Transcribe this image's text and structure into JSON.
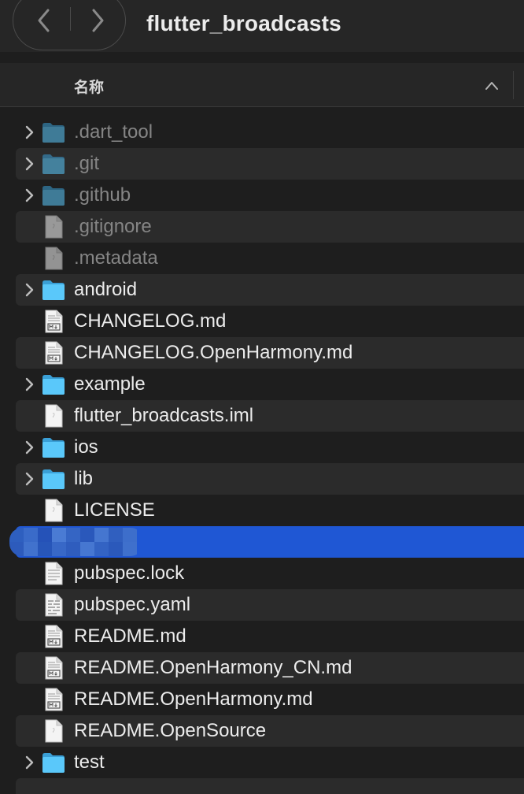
{
  "window": {
    "title": "flutter_broadcasts"
  },
  "toolbar": {
    "back_icon": "chevron-left-icon",
    "forward_icon": "chevron-right-icon"
  },
  "columns": {
    "name_label": "名称",
    "sort_icon": "chevron-up-icon",
    "sort_direction": "ascending"
  },
  "colors": {
    "background": "#1e1e1e",
    "stripe": "#2b2b2b",
    "selection": "#1f57d4",
    "folder": "#5ac8fa",
    "dim_text": "#858585"
  },
  "files": [
    {
      "name": ".dart_tool",
      "kind": "folder",
      "hidden": true
    },
    {
      "name": ".git",
      "kind": "folder",
      "hidden": true
    },
    {
      "name": ".github",
      "kind": "folder",
      "hidden": true
    },
    {
      "name": ".gitignore",
      "kind": "file",
      "hidden": true
    },
    {
      "name": ".metadata",
      "kind": "file",
      "hidden": true
    },
    {
      "name": "android",
      "kind": "folder",
      "hidden": false
    },
    {
      "name": "CHANGELOG.md",
      "kind": "markdown",
      "hidden": false
    },
    {
      "name": "CHANGELOG.OpenHarmony.md",
      "kind": "markdown",
      "hidden": false
    },
    {
      "name": "example",
      "kind": "folder",
      "hidden": false
    },
    {
      "name": "flutter_broadcasts.iml",
      "kind": "file",
      "hidden": false
    },
    {
      "name": "ios",
      "kind": "folder",
      "hidden": false
    },
    {
      "name": "lib",
      "kind": "folder",
      "hidden": false
    },
    {
      "name": "LICENSE",
      "kind": "file",
      "hidden": false
    },
    {
      "name": "",
      "kind": "redacted",
      "hidden": false,
      "selected": true
    },
    {
      "name": "pubspec.lock",
      "kind": "text",
      "hidden": false
    },
    {
      "name": "pubspec.yaml",
      "kind": "yaml",
      "hidden": false
    },
    {
      "name": "README.md",
      "kind": "markdown",
      "hidden": false
    },
    {
      "name": "README.OpenHarmony_CN.md",
      "kind": "markdown",
      "hidden": false
    },
    {
      "name": "README.OpenHarmony.md",
      "kind": "markdown",
      "hidden": false
    },
    {
      "name": "README.OpenSource",
      "kind": "file",
      "hidden": false
    },
    {
      "name": "test",
      "kind": "folder",
      "hidden": false
    }
  ]
}
